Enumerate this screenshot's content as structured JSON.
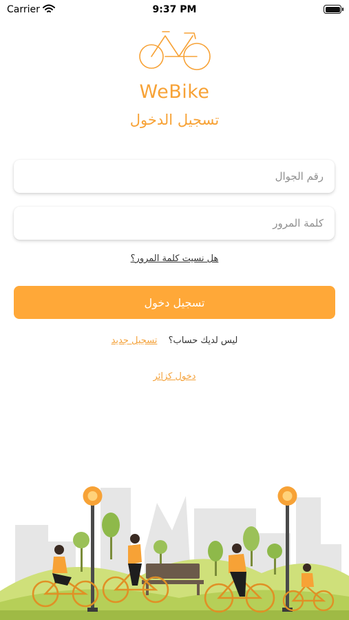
{
  "status_bar": {
    "carrier": "Carrier",
    "time": "9:37 PM"
  },
  "brand": {
    "name": "WeBike",
    "accent_color": "#f7a236"
  },
  "screen": {
    "title": "تسجيل الدخول"
  },
  "form": {
    "phone_placeholder": "رقم الجوال",
    "password_placeholder": "كلمة المرور",
    "forgot_password": "هل نسيت كلمة المرور؟",
    "login_button": "تسجيل دخول",
    "no_account_text": "ليس لديك حساب؟",
    "signup_link": "تسجيل جديد",
    "guest_link": "دخول كزائر"
  },
  "icons": {
    "logo": "bicycle-logo-icon",
    "wifi": "wifi-icon",
    "battery": "battery-icon"
  }
}
